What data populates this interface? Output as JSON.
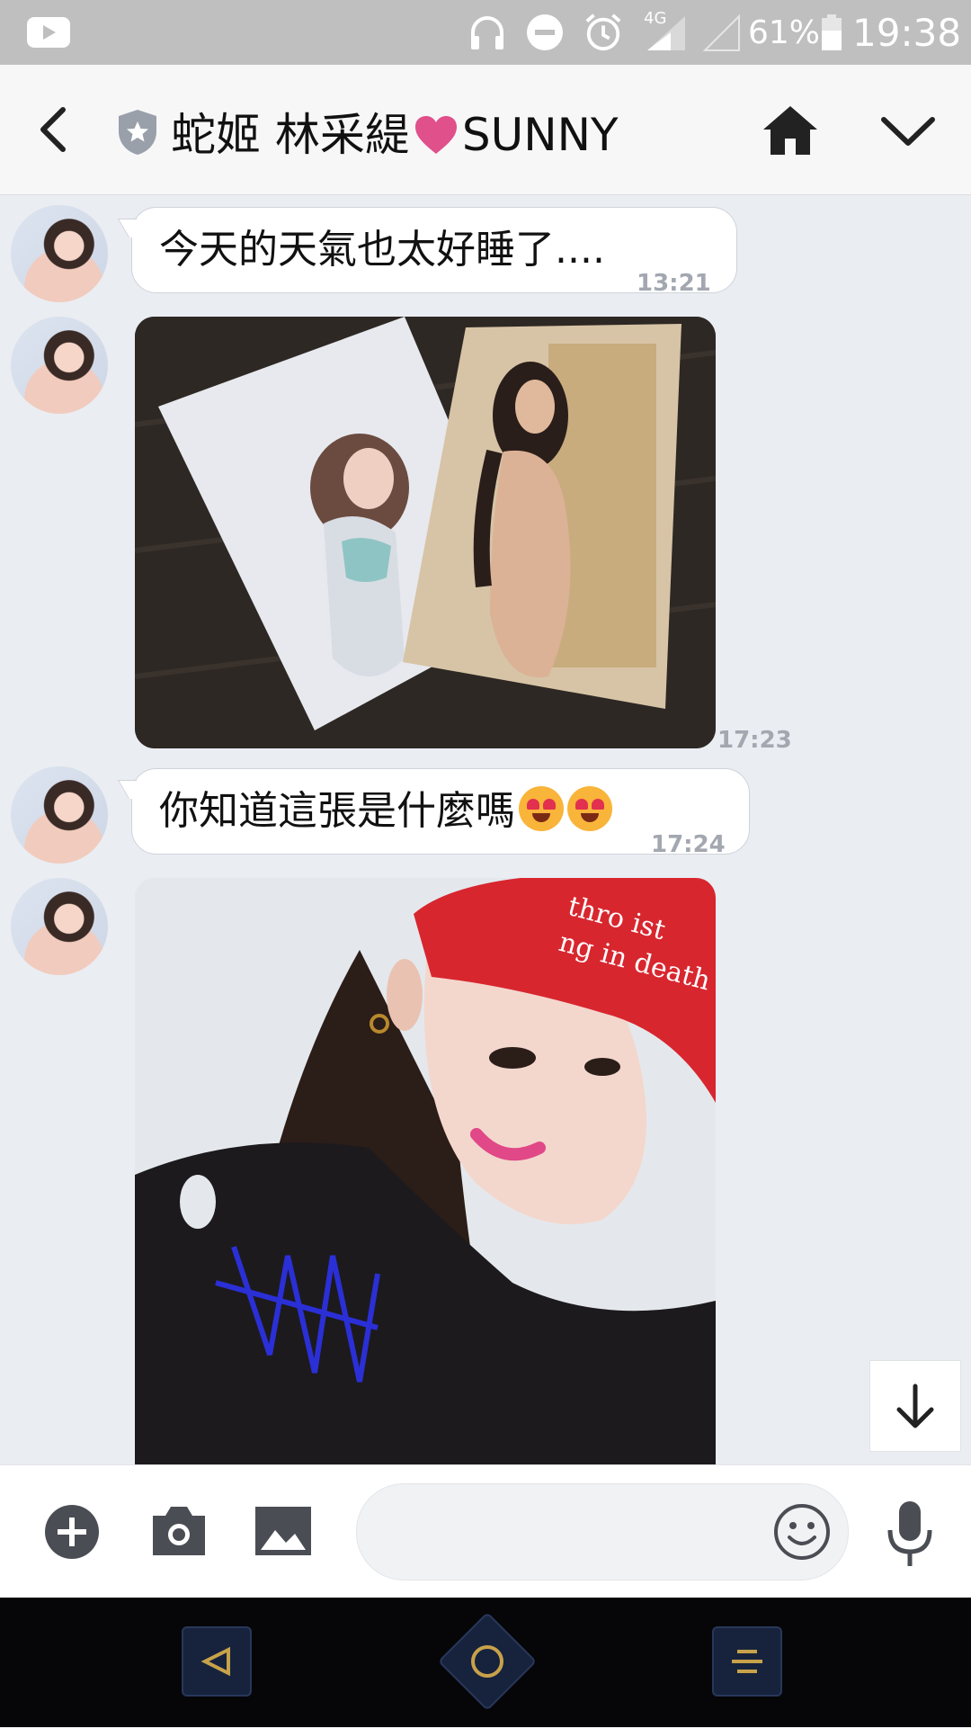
{
  "status_bar": {
    "network_label": "4G",
    "battery_percent": "61%",
    "time": "19:38",
    "icons": [
      "youtube-icon",
      "headphones-icon",
      "do-not-disturb-icon",
      "alarm-icon",
      "signal-4g-icon",
      "signal-empty-icon",
      "battery-icon"
    ]
  },
  "header": {
    "title_part1": "蛇姬 林采緹",
    "title_part2": "SUNNY",
    "icons": [
      "back-arrow-icon",
      "verified-shield-icon",
      "heart-icon",
      "home-icon",
      "chevron-down-icon"
    ],
    "accent_heart": "#e0508a"
  },
  "messages": [
    {
      "type": "text",
      "text": "今天的天氣也太好睡了....",
      "time": "13:21"
    },
    {
      "type": "image",
      "description": "two posters on floor",
      "time": "17:23"
    },
    {
      "type": "text",
      "text": "你知道這張是什麼嗎",
      "emoji": "heart-eyes-emoji",
      "time": "17:24"
    },
    {
      "type": "image",
      "cap_text_line1": "thro ist",
      "cap_text_line2": "ng in death"
    }
  ],
  "input_bar": {
    "placeholder": "",
    "icons": [
      "plus-icon",
      "camera-icon",
      "gallery-icon",
      "emoji-icon",
      "microphone-icon"
    ]
  },
  "nav_bar": {
    "icons": [
      "nav-back-icon",
      "nav-home-icon",
      "nav-recents-icon"
    ],
    "accent": "#c8a24a"
  }
}
